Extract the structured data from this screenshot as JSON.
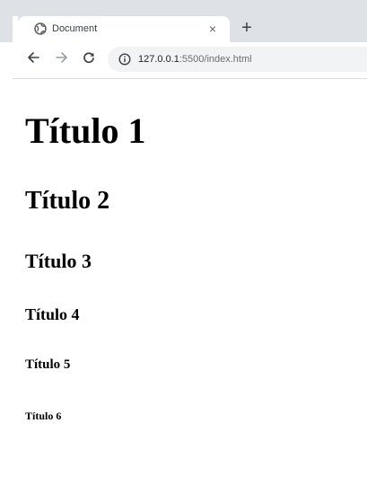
{
  "browser": {
    "tab": {
      "title": "Document",
      "favicon": "globe-icon",
      "close_label": "×"
    },
    "new_tab_label": "+",
    "toolbar": {
      "back_icon": "arrow-left-icon",
      "forward_icon": "arrow-right-icon",
      "reload_icon": "reload-icon",
      "info_icon": "info-icon"
    },
    "address_bar": {
      "host": "127.0.0.1",
      "path": ":5500/index.html"
    }
  },
  "page": {
    "headings": {
      "h1": "Título 1",
      "h2": "Título 2",
      "h3": "Título 3",
      "h4": "Título 4",
      "h5": "Título 5",
      "h6": "Título 6"
    }
  },
  "colors": {
    "tab_strip": "#dee1e6",
    "omnibox": "#f1f3f4",
    "icon": "#5f6368",
    "text": "#000000"
  }
}
